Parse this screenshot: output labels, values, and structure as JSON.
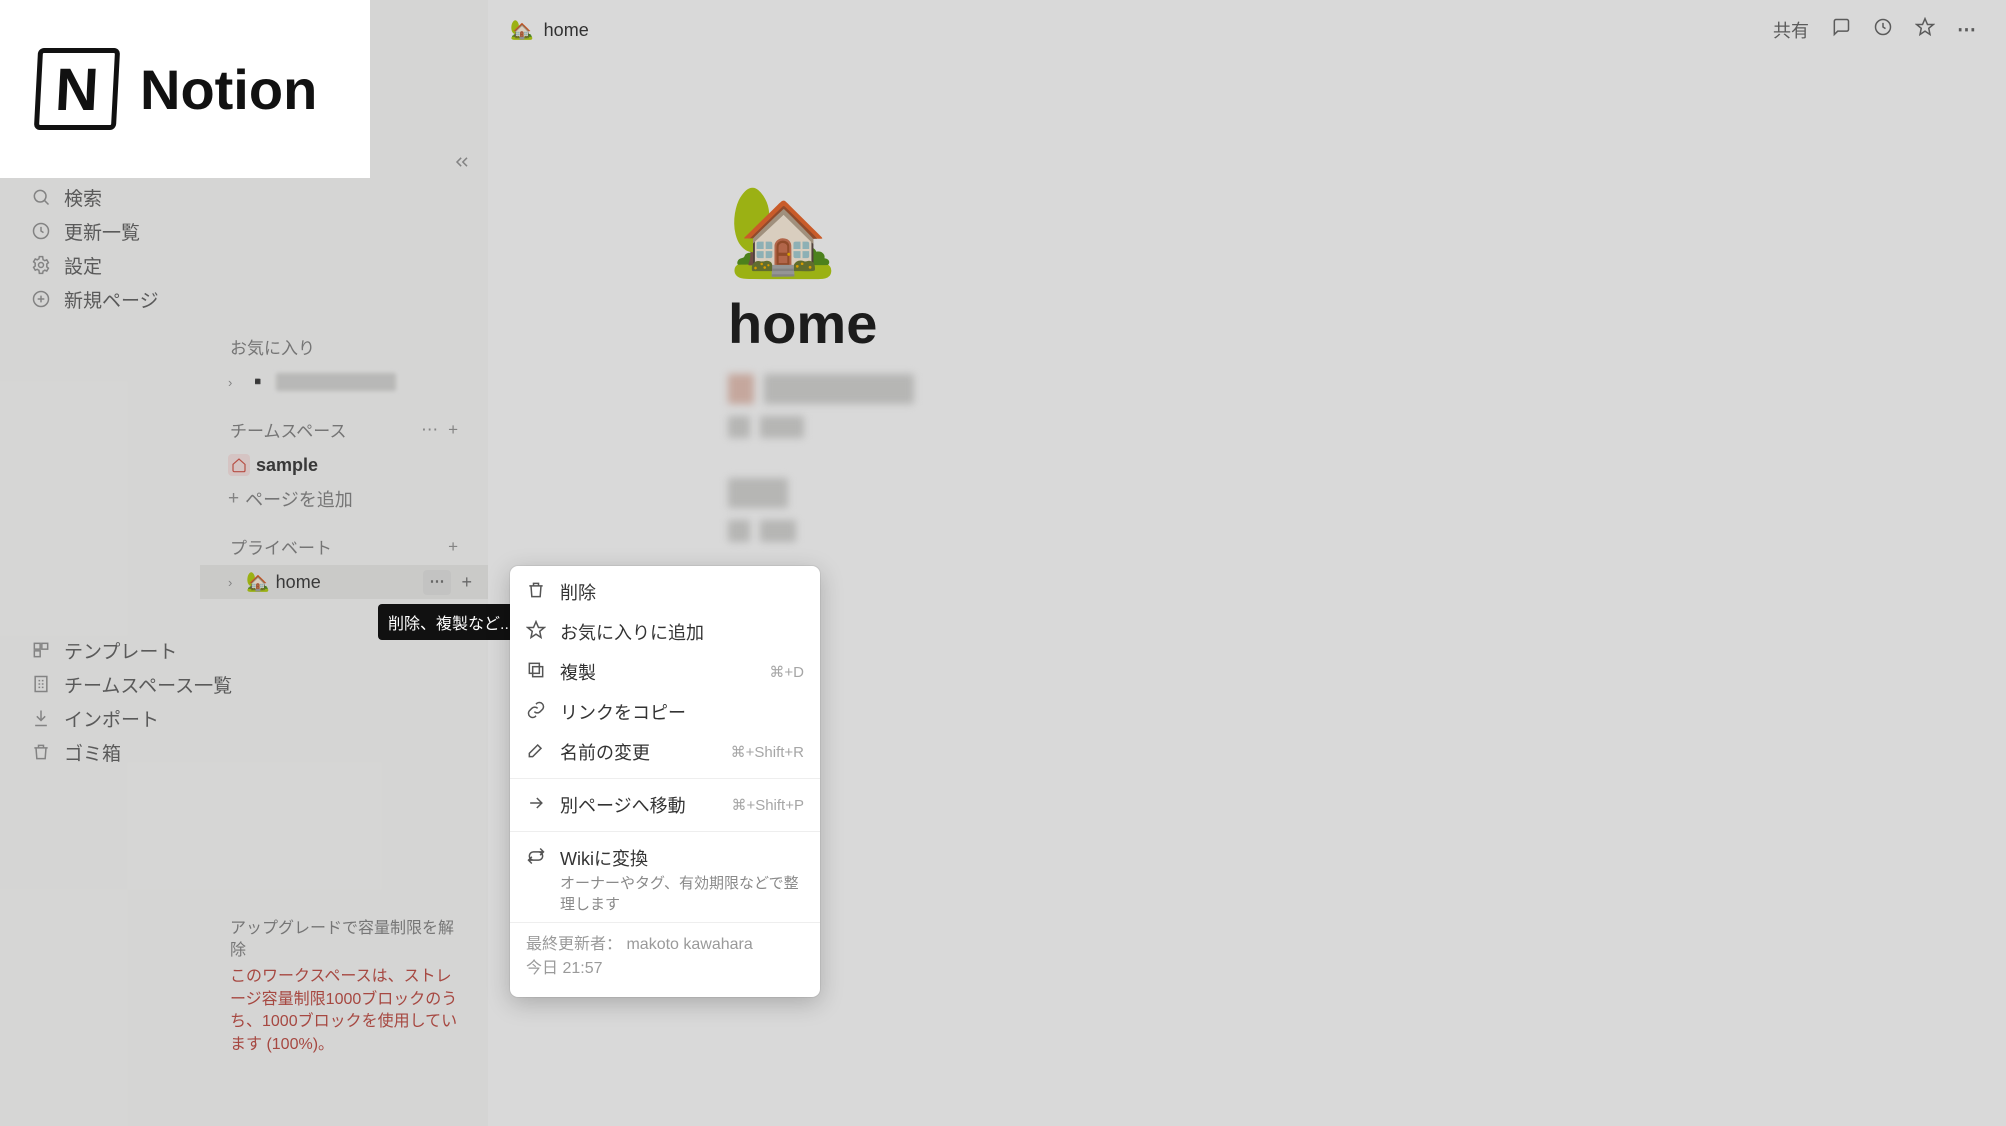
{
  "logo": {
    "brand": "Notion"
  },
  "sidebar": {
    "nav": {
      "search": "検索",
      "updates": "更新一覧",
      "settings": "設定",
      "newpage": "新規ページ"
    },
    "favorites": {
      "header": "お気に入り"
    },
    "teamspaces": {
      "header": "チームスペース",
      "sample_label": "sample",
      "add_page": "ページを追加"
    },
    "private": {
      "header": "プライベート",
      "home_label": "home",
      "home_emoji": "🏡"
    },
    "bottom": {
      "templates": "テンプレート",
      "teamspace_list": "チームスペース一覧",
      "import": "インポート",
      "trash": "ゴミ箱"
    },
    "upgrade": {
      "title": "アップグレードで容量制限を解除",
      "message": "このワークスペースは、ストレージ容量制限1000ブロックのうち、1000ブロックを使用しています (100%)。"
    }
  },
  "tooltip": "削除、複製など...",
  "topbar": {
    "crumb_emoji": "🏡",
    "crumb_title": "home",
    "share": "共有"
  },
  "page": {
    "emoji": "🏡",
    "title": "home"
  },
  "context_menu": {
    "delete": "削除",
    "favorite": "お気に入りに追加",
    "duplicate": "複製",
    "duplicate_shortcut": "⌘+D",
    "copy_link": "リンクをコピー",
    "rename": "名前の変更",
    "rename_shortcut": "⌘+Shift+R",
    "move_to": "別ページへ移動",
    "move_shortcut": "⌘+Shift+P",
    "wiki": "Wikiに変換",
    "wiki_sub": "オーナーやタグ、有効期限などで整理します",
    "footer_by_label": "最終更新者：",
    "footer_by_value": "makoto kawahara",
    "footer_time": "今日 21:57"
  }
}
